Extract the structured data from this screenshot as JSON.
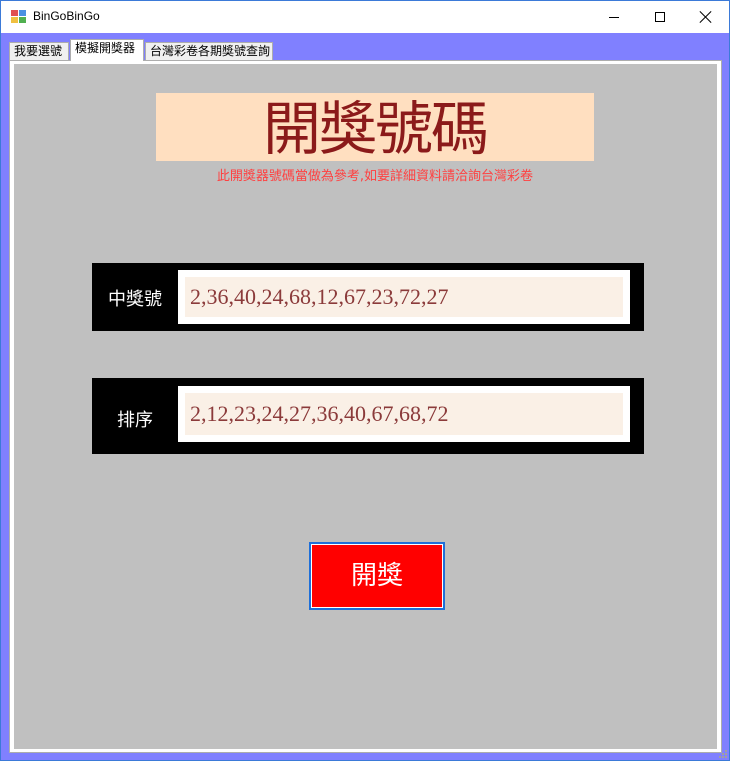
{
  "window": {
    "title": "BinGoBinGo"
  },
  "tabs": [
    {
      "label": "我要選號"
    },
    {
      "label": "模擬開獎器"
    },
    {
      "label": "台灣彩卷各期獎號查詢"
    }
  ],
  "active_tab": "模擬開獎器",
  "main": {
    "heading": "開獎號碼",
    "disclaimer": "此開獎器號碼當做為參考,如要詳細資料請洽詢台灣彩卷",
    "winning_label": "中獎號",
    "winning_value": "2,36,40,24,68,12,67,23,72,27",
    "sorted_label": "排序",
    "sorted_value": "2,12,23,24,27,36,40,67,68,72",
    "draw_button": "開獎"
  },
  "colors": {
    "window_background": "#8080ff",
    "panel_background": "#c0c0c0",
    "heading_background": "#ffdfc0",
    "heading_text": "#8b1a1a",
    "disclaimer_text": "#ff4040",
    "draw_button_background": "#ff0000",
    "row_background": "#000000",
    "field_background": "#faf0e6"
  }
}
